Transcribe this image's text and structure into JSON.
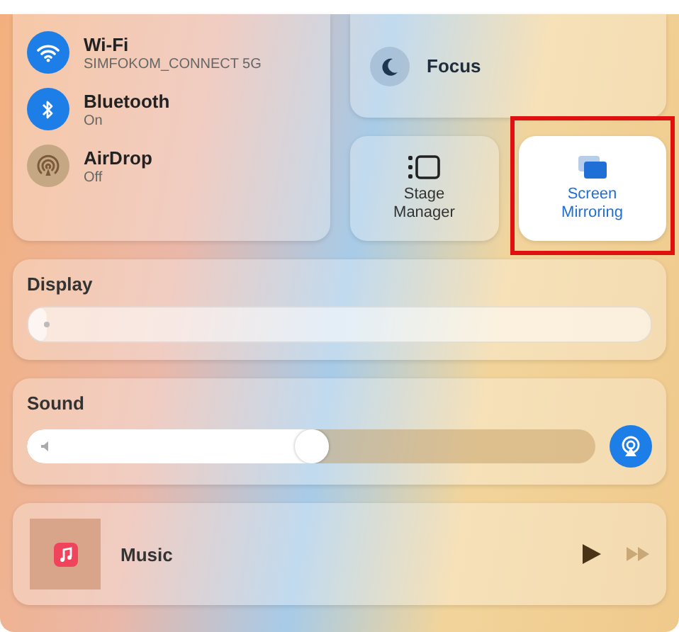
{
  "connectivity": [
    {
      "kind": "wifi",
      "name": "Wi-Fi",
      "status": "SIMFOKOM_CONNECT 5G",
      "on": true
    },
    {
      "kind": "bluetooth",
      "name": "Bluetooth",
      "status": "On",
      "on": true
    },
    {
      "kind": "airdrop",
      "name": "AirDrop",
      "status": "Off",
      "on": false
    }
  ],
  "focus": {
    "label": "Focus"
  },
  "tiles": [
    {
      "kind": "stage",
      "label": "Stage Manager",
      "selected": false,
      "highlighted": false
    },
    {
      "kind": "mirror",
      "label": "Screen Mirroring",
      "selected": true,
      "highlighted": true
    }
  ],
  "display": {
    "title": "Display",
    "level": 0.03
  },
  "sound": {
    "title": "Sound",
    "level": 0.53
  },
  "now_playing": {
    "app": "Music"
  }
}
